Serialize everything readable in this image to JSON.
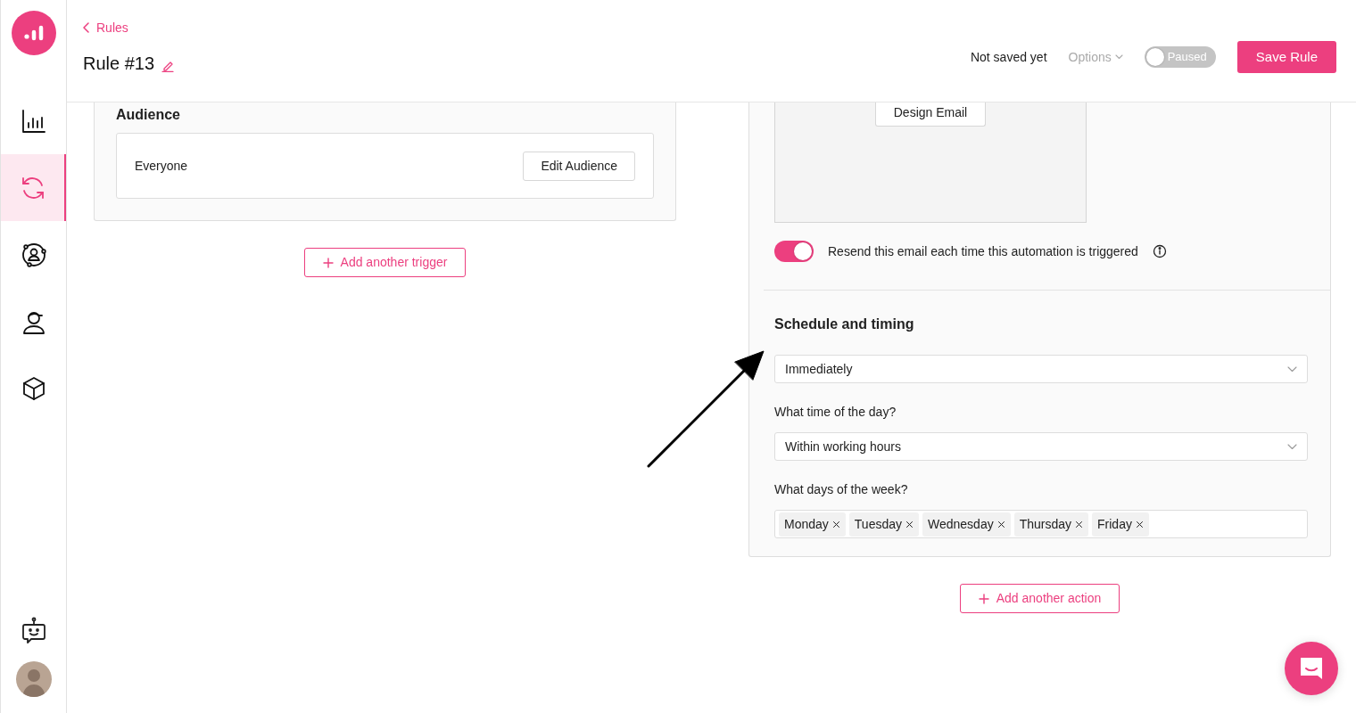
{
  "sidebar": {
    "items": [
      {
        "selected": false
      },
      {
        "selected": true
      },
      {
        "selected": false
      },
      {
        "selected": false
      },
      {
        "selected": false
      }
    ]
  },
  "header": {
    "breadcrumb": "Rules",
    "title": "Rule #13",
    "save_status": "Not saved yet",
    "options": "Options",
    "status_toggle": {
      "label": "Paused",
      "on": false
    },
    "save_button": "Save Rule"
  },
  "trigger": {
    "audience_title": "Audience",
    "audience": "Everyone",
    "edit_button": "Edit Audience",
    "add_button": "Add another trigger"
  },
  "action": {
    "design_button": "Design Email",
    "resend": {
      "label": "Resend this email each time this automation is triggered",
      "on": true
    },
    "schedule_title": "Schedule and timing",
    "timing": {
      "value": "Immediately"
    },
    "time_label": "What time of the day?",
    "time": {
      "value": "Within working hours"
    },
    "days_label": "What days of the week?",
    "days": [
      "Monday",
      "Tuesday",
      "Wednesday",
      "Thursday",
      "Friday"
    ],
    "add_button": "Add another action"
  }
}
